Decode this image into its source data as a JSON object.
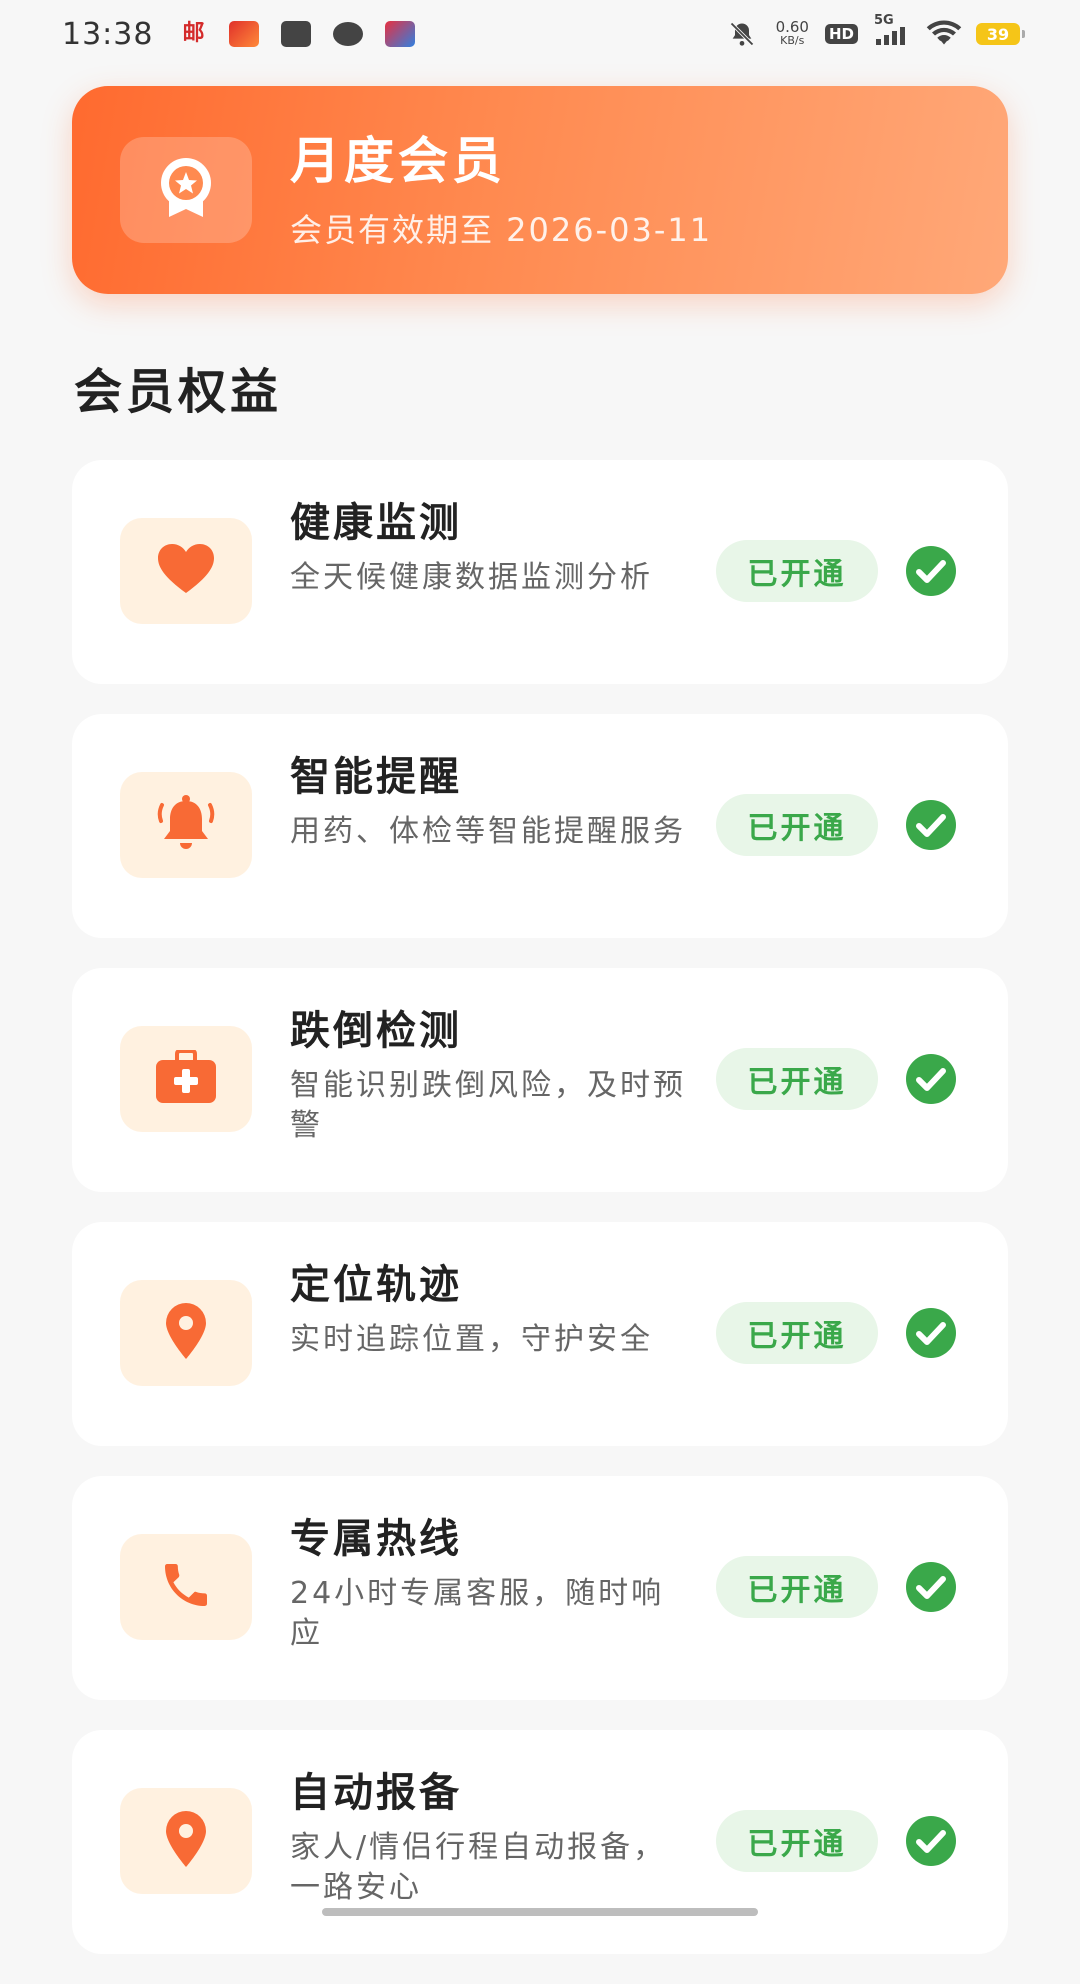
{
  "status_bar": {
    "time": "13:38",
    "net_speed_value": "0.60",
    "net_speed_unit": "KB/s",
    "hd_label": "HD",
    "network_label": "5G",
    "battery_level": "39",
    "postal_glyph": "邮"
  },
  "member_banner": {
    "title": "月度会员",
    "subtitle": "会员有效期至 2026-03-11",
    "icon": "medal-star-icon"
  },
  "section": {
    "title": "会员权益"
  },
  "benefits": [
    {
      "title": "健康监测",
      "desc": "全天候健康数据监测分析",
      "icon": "heart-icon",
      "status": "已开通"
    },
    {
      "title": "智能提醒",
      "desc": "用药、体检等智能提醒服务",
      "icon": "bell-icon",
      "status": "已开通"
    },
    {
      "title": "跌倒检测",
      "desc": "智能识别跌倒风险，及时预警",
      "icon": "medical-kit-icon",
      "status": "已开通"
    },
    {
      "title": "定位轨迹",
      "desc": "实时追踪位置，守护安全",
      "icon": "location-pin-icon",
      "status": "已开通"
    },
    {
      "title": "专属热线",
      "desc": "24小时专属客服，随时响应",
      "icon": "phone-icon",
      "status": "已开通"
    },
    {
      "title": "自动报备",
      "desc": "家人/情侣行程自动报备，一路安心",
      "icon": "location-pin-icon",
      "status": "已开通"
    }
  ],
  "colors": {
    "accent": "#ff6a2f",
    "icon_orange": "#f86a35",
    "icon_bg": "#fff1e0",
    "success_green": "#3aa84a",
    "success_bg": "#e8f6e8"
  }
}
